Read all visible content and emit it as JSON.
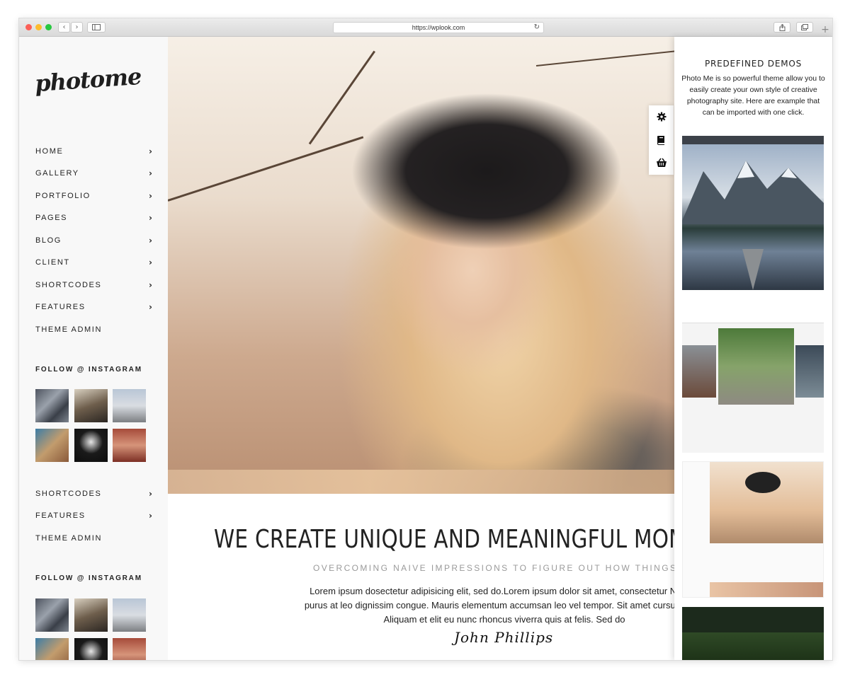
{
  "browser": {
    "url": "https://wplook.com"
  },
  "sidebar": {
    "logo": "photome",
    "nav_primary": [
      "HOME",
      "GALLERY",
      "PORTFOLIO",
      "PAGES",
      "BLOG",
      "CLIENT",
      "SHORTCODES",
      "FEATURES",
      "THEME ADMIN"
    ],
    "instagram_title": "FOLLOW @ INSTAGRAM",
    "nav_secondary": [
      "SHORTCODES",
      "FEATURES",
      "THEME ADMIN"
    ],
    "instagram_title_2": "FOLLOW @ INSTAGRAM"
  },
  "main": {
    "headline": "WE CREATE UNIQUE AND MEANINGFUL MOMENTS TH",
    "subheadline": "OVERCOMING NAIVE IMPRESSIONS TO FIGURE OUT HOW THINGS REALLY WO",
    "body_line1": "Lorem ipsum dosectetur adipisicing elit, sed do.Lorem ipsum dolor sit amet, consectetur Nulla fr",
    "body_line2": "purus at leo dignissim congue. Mauris elementum accumsan leo vel tempor. Sit amet cursus nisl a",
    "body_line3": "Aliquam et elit eu nunc rhoncus viverra quis at felis. Sed do",
    "signature": "John Phillips"
  },
  "tools": [
    "gear-icon",
    "book-icon",
    "basket-icon"
  ],
  "panel": {
    "title": "PREDEFINED DEMOS",
    "description": "Photo Me is so powerful theme allow you to easily create your own style of creative photography site. Here are example that can be imported with one click."
  }
}
